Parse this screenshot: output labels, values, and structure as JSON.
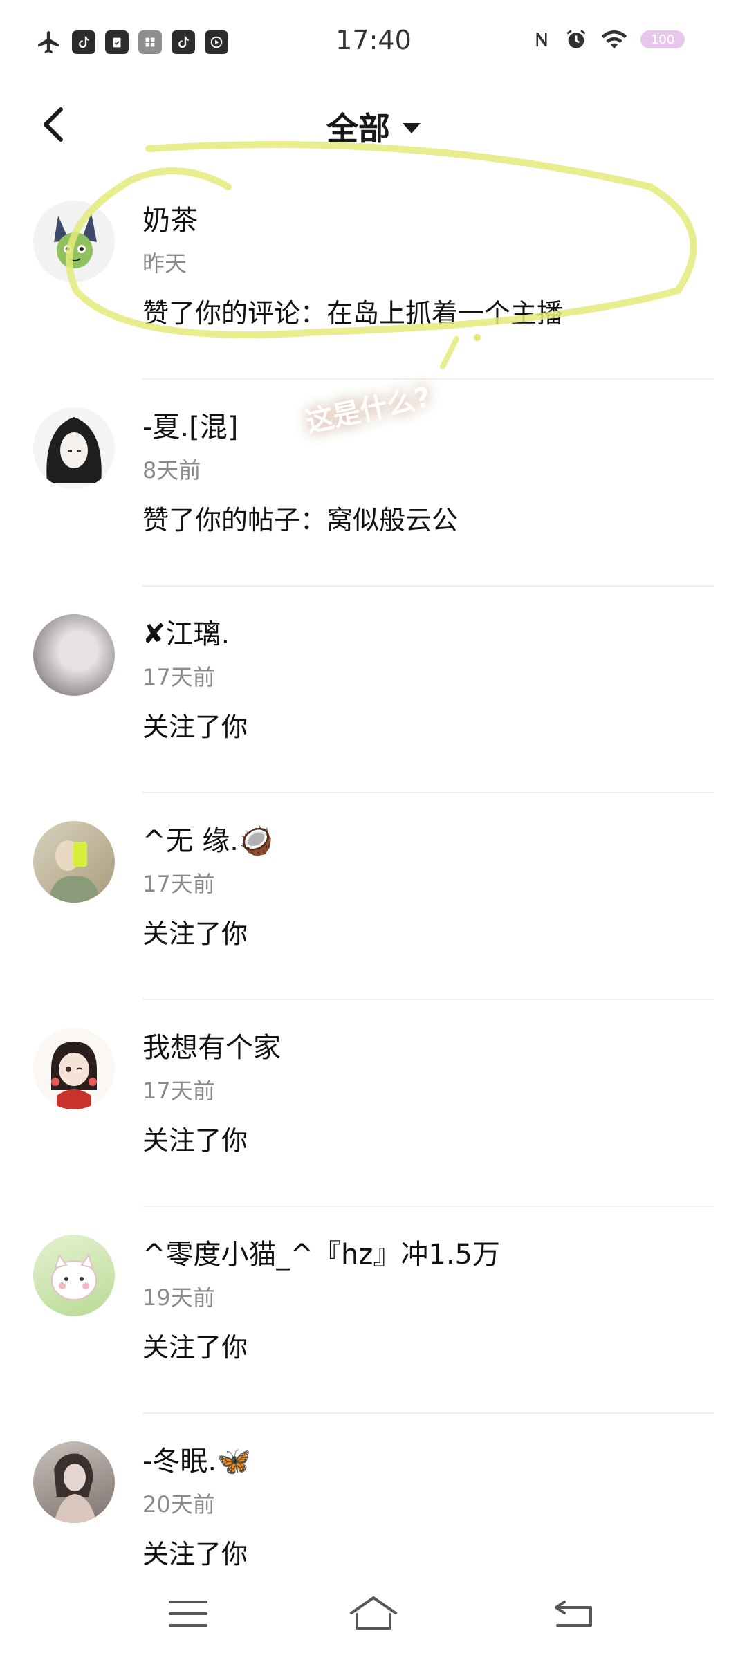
{
  "status_bar": {
    "time": "17:40",
    "battery": "100",
    "left_icons": [
      "airplane-icon",
      "tiktok-icon",
      "clipboard-icon",
      "gallery-icon",
      "tiktok-icon",
      "video-icon"
    ],
    "right_icons": [
      "nfc-icon",
      "alarm-icon",
      "wifi-icon"
    ]
  },
  "header": {
    "title": "全部",
    "back_icon": "chevron-left-icon",
    "dropdown_icon": "caret-down-icon"
  },
  "notifications": [
    {
      "name": "奶茶",
      "time": "昨天",
      "action": "赞了你的评论：在岛上抓着一个主播",
      "avatar_color": "#6fa06a"
    },
    {
      "name": "-夏.[混]",
      "time": "8天前",
      "action": "赞了你的帖子：窝似般云公",
      "avatar_color": "#2a2a2a"
    },
    {
      "name": "✘江璃.",
      "time": "17天前",
      "action": "关注了你",
      "avatar_color": "#b9b2b7"
    },
    {
      "name": "^无 缘.🥥",
      "time": "17天前",
      "action": "关注了你",
      "avatar_color": "#c2b79a"
    },
    {
      "name": "我想有个家",
      "time": "17天前",
      "action": "关注了你",
      "avatar_color": "#e9d6cf"
    },
    {
      "name": "^零度小猫_^『hz』冲1.5万",
      "time": "19天前",
      "action": "关注了你",
      "avatar_color": "#cfe7b8"
    },
    {
      "name": "-冬眠.🦋",
      "time": "20天前",
      "action": "关注了你",
      "avatar_color": "#9c8f8a"
    }
  ],
  "annotation": {
    "sticker_text": "这是什么?",
    "highlight_color": "#e4ea7a"
  },
  "nav_bar": {
    "icons": [
      "menu-icon",
      "home-icon",
      "back-icon"
    ]
  }
}
